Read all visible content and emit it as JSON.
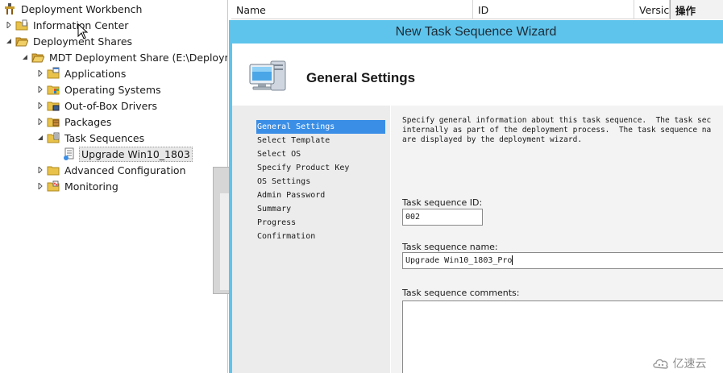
{
  "tree": {
    "root": "Deployment Workbench",
    "information_center": "Information Center",
    "deployment_shares": "Deployment Shares",
    "mdt_share": "MDT Deployment Share (E:\\Deployme",
    "applications": "Applications",
    "operating_systems": "Operating Systems",
    "out_of_box_drivers": "Out-of-Box Drivers",
    "packages": "Packages",
    "task_sequences": "Task Sequences",
    "upgrade_item": "Upgrade Win10_1803",
    "advanced_configuration": "Advanced Configuration",
    "monitoring": "Monitoring"
  },
  "list_header": {
    "name": "Name",
    "id": "ID",
    "version": "Versic",
    "actions": "操作"
  },
  "wizard": {
    "title": "New Task Sequence Wizard",
    "page_title": "General Settings",
    "steps": [
      "General Settings",
      "Select Template",
      "Select OS",
      "Specify Product Key",
      "OS Settings",
      "Admin Password",
      "Summary",
      "Progress",
      "Confirmation"
    ],
    "active_step": "General Settings",
    "description_lines": [
      "Specify general information about this task sequence.  The task sec",
      "internally as part of the deployment process.  The task sequence na",
      "are displayed by the deployment wizard."
    ],
    "id_label": "Task sequence ID:",
    "id_value": "002",
    "name_label": "Task sequence name:",
    "name_value": "Upgrade Win10_1803_Pro",
    "comments_label": "Task sequence comments:",
    "comments_value": ""
  },
  "watermark": {
    "text": "亿速云"
  },
  "colors": {
    "wizard_frame": "#5ec4ec",
    "active_step": "#3a8ee6",
    "steps_bg": "#ececec"
  },
  "icons": {
    "root": "workbench-icon",
    "folder": "folder-icon",
    "folder_open": "folder-open-icon",
    "task_sequence": "task-sequence-icon",
    "wizard_header": "computer-icon",
    "watermark": "cloud-icon"
  }
}
